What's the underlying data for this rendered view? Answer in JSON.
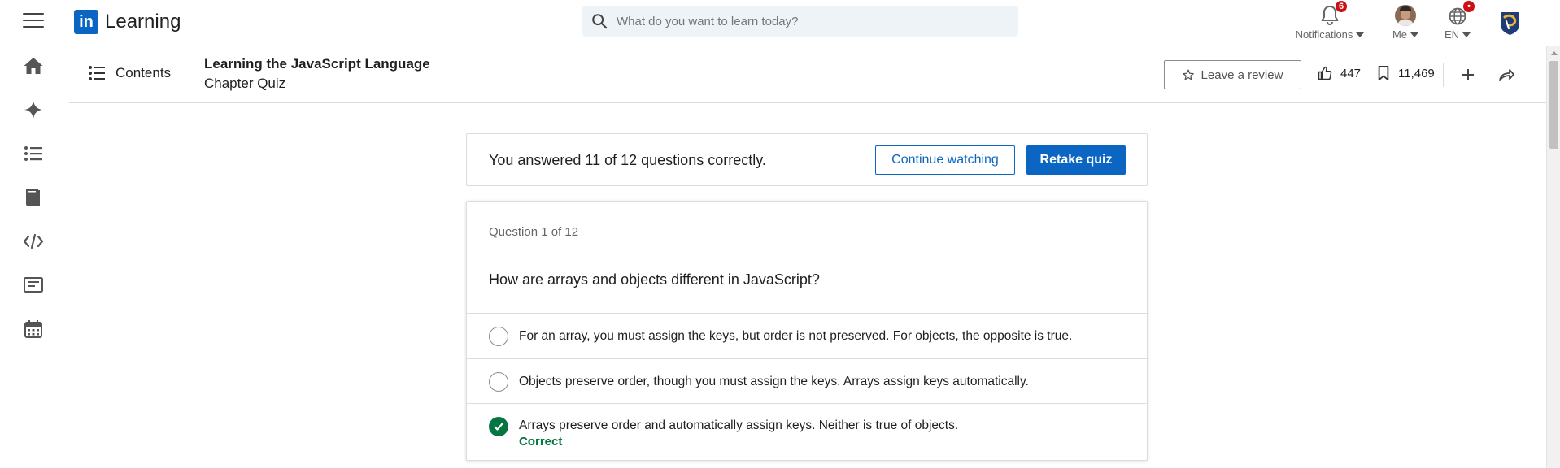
{
  "topnav": {
    "brand_badge": "in",
    "brand_name": "Learning",
    "search_placeholder": "What do you want to learn today?",
    "notifications": {
      "label": "Notifications",
      "badge": "6"
    },
    "me": {
      "label": "Me"
    },
    "language": {
      "label": "EN",
      "badge": "•"
    }
  },
  "course": {
    "contents_label": "Contents",
    "title": "Learning the JavaScript Language",
    "subtitle": "Chapter Quiz",
    "review_label": "Leave a review",
    "likes": "447",
    "saves": "11,469"
  },
  "result": {
    "text": "You answered 11 of 12 questions correctly.",
    "continue_label": "Continue watching",
    "retake_label": "Retake quiz"
  },
  "question": {
    "number": "Question 1 of 12",
    "text": "How are arrays and objects different in JavaScript?",
    "options": [
      {
        "text": "For an array, you must assign the keys, but order is not preserved. For objects, the opposite is true."
      },
      {
        "text": "Objects preserve order, though you must assign the keys. Arrays assign keys automatically."
      },
      {
        "text": "Arrays preserve order and automatically assign keys. Neither is true of objects.",
        "status": "Correct"
      }
    ]
  },
  "colors": {
    "brand_blue": "#0a66c2",
    "correct_green": "#057642",
    "badge_red": "#cc1016"
  },
  "icons": {
    "left_rail": [
      "home-icon",
      "sparkle-icon",
      "list-icon",
      "book-icon",
      "code-icon",
      "certificate-icon",
      "calendar-icon"
    ]
  }
}
